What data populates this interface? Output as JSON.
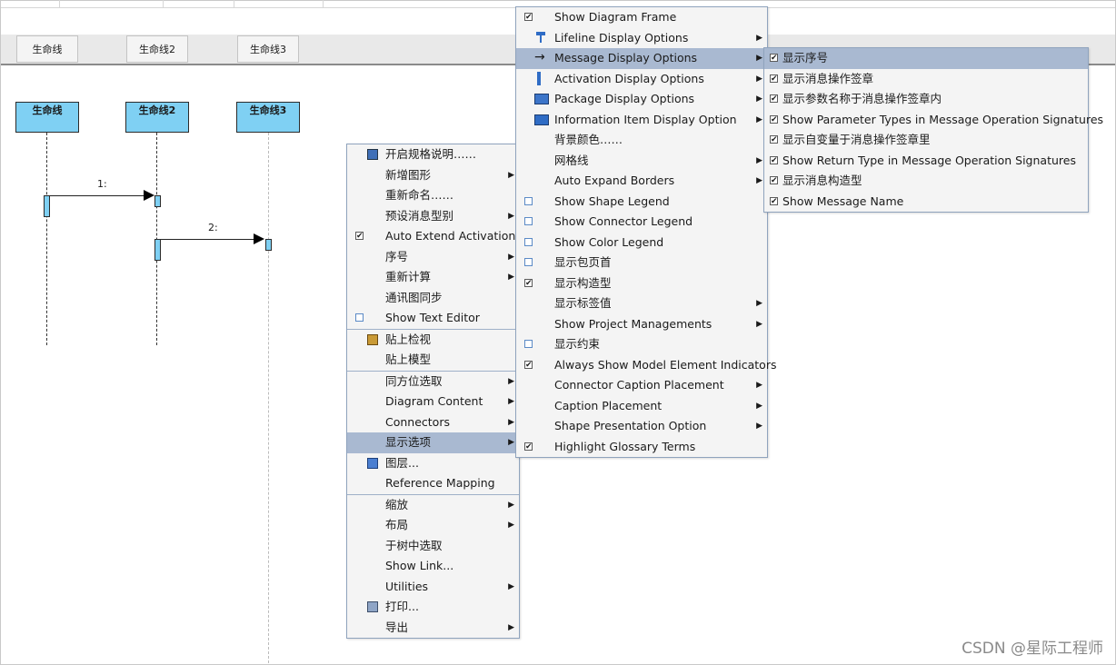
{
  "diagram": {
    "lane_tabs": [
      "生命线",
      "生命线2",
      "生命线3"
    ],
    "lifelines": [
      "生命线",
      "生命线2",
      "生命线3"
    ],
    "messages": [
      "1:",
      "2:"
    ]
  },
  "context_menu": {
    "group1": [
      {
        "label": "开启规格说明……",
        "icon": "spec-doc-icon",
        "submenu": false
      },
      {
        "label": "新增图形",
        "submenu": true
      },
      {
        "label": "重新命名……",
        "submenu": false
      },
      {
        "label": "预设消息型别",
        "submenu": true
      },
      {
        "label": "Auto Extend Activations",
        "checkbox": "on",
        "submenu": false
      },
      {
        "label": "序号",
        "submenu": true
      },
      {
        "label": "重新计算",
        "submenu": true
      },
      {
        "label": "通讯图同步",
        "submenu": false
      },
      {
        "label": "Show Text Editor",
        "checkbox": "off",
        "submenu": false
      }
    ],
    "group2": [
      {
        "label": "贴上检视",
        "icon": "clipboard-icon"
      },
      {
        "label": "贴上模型"
      }
    ],
    "group3": [
      {
        "label": "同方位选取",
        "submenu": true
      },
      {
        "label": "Diagram Content",
        "submenu": true
      },
      {
        "label": "Connectors",
        "submenu": true
      },
      {
        "label": "显示选项",
        "submenu": true,
        "highlighted": true
      },
      {
        "label": "图层...",
        "icon": "layers-icon"
      },
      {
        "label": "Reference Mapping"
      }
    ],
    "group4": [
      {
        "label": "缩放",
        "submenu": true
      },
      {
        "label": "布局",
        "submenu": true
      },
      {
        "label": "于树中选取"
      },
      {
        "label": "Show Link..."
      },
      {
        "label": "Utilities",
        "submenu": true
      },
      {
        "label": "打印...",
        "icon": "printer-icon"
      },
      {
        "label": "导出",
        "submenu": true
      }
    ]
  },
  "display_menu": {
    "items": [
      {
        "label": "Show Diagram Frame",
        "checkbox": "on"
      },
      {
        "label": "Lifeline Display Options",
        "icon": "lifeline-icon",
        "submenu": true
      },
      {
        "label": "Message Display Options",
        "icon": "arrow-icon",
        "submenu": true,
        "highlighted": true
      },
      {
        "label": "Activation Display Options",
        "icon": "activation-icon",
        "submenu": true
      },
      {
        "label": "Package Display Options",
        "icon": "package-icon",
        "submenu": true
      },
      {
        "label": "Information Item Display Option",
        "icon": "info-item-icon",
        "submenu": true
      },
      {
        "label": "背景颜色……"
      },
      {
        "label": "网格线",
        "submenu": true
      },
      {
        "label": "Auto Expand Borders",
        "submenu": true
      },
      {
        "label": "Show Shape Legend",
        "checkbox": "off"
      },
      {
        "label": "Show Connector Legend",
        "checkbox": "off"
      },
      {
        "label": "Show Color Legend",
        "checkbox": "off"
      },
      {
        "label": "显示包页首",
        "checkbox": "off"
      },
      {
        "label": "显示构造型",
        "checkbox": "on"
      },
      {
        "label": "显示标签值",
        "submenu": true
      },
      {
        "label": "Show Project Managements",
        "submenu": true
      },
      {
        "label": "显示约束",
        "checkbox": "off"
      },
      {
        "label": "Always Show Model Element Indicators",
        "checkbox": "on"
      },
      {
        "label": "Connector Caption Placement",
        "submenu": true
      },
      {
        "label": "Caption Placement",
        "submenu": true
      },
      {
        "label": "Shape Presentation Option",
        "submenu": true
      },
      {
        "label": "Highlight Glossary Terms",
        "checkbox": "on"
      }
    ]
  },
  "message_menu": {
    "items": [
      {
        "label": "显示序号",
        "checkbox": "on",
        "highlighted": true
      },
      {
        "label": "显示消息操作签章",
        "checkbox": "on"
      },
      {
        "label": "显示参数名称于消息操作签章内",
        "checkbox": "on"
      },
      {
        "label": "Show Parameter Types in Message Operation Signatures",
        "checkbox": "on"
      },
      {
        "label": "显示自变量于消息操作签章里",
        "checkbox": "on"
      },
      {
        "label": "Show Return Type in Message Operation Signatures",
        "checkbox": "on"
      },
      {
        "label": "显示消息构造型",
        "checkbox": "on"
      },
      {
        "label": "Show Message Name",
        "checkbox": "on"
      }
    ]
  },
  "watermark": "CSDN @星际工程师"
}
